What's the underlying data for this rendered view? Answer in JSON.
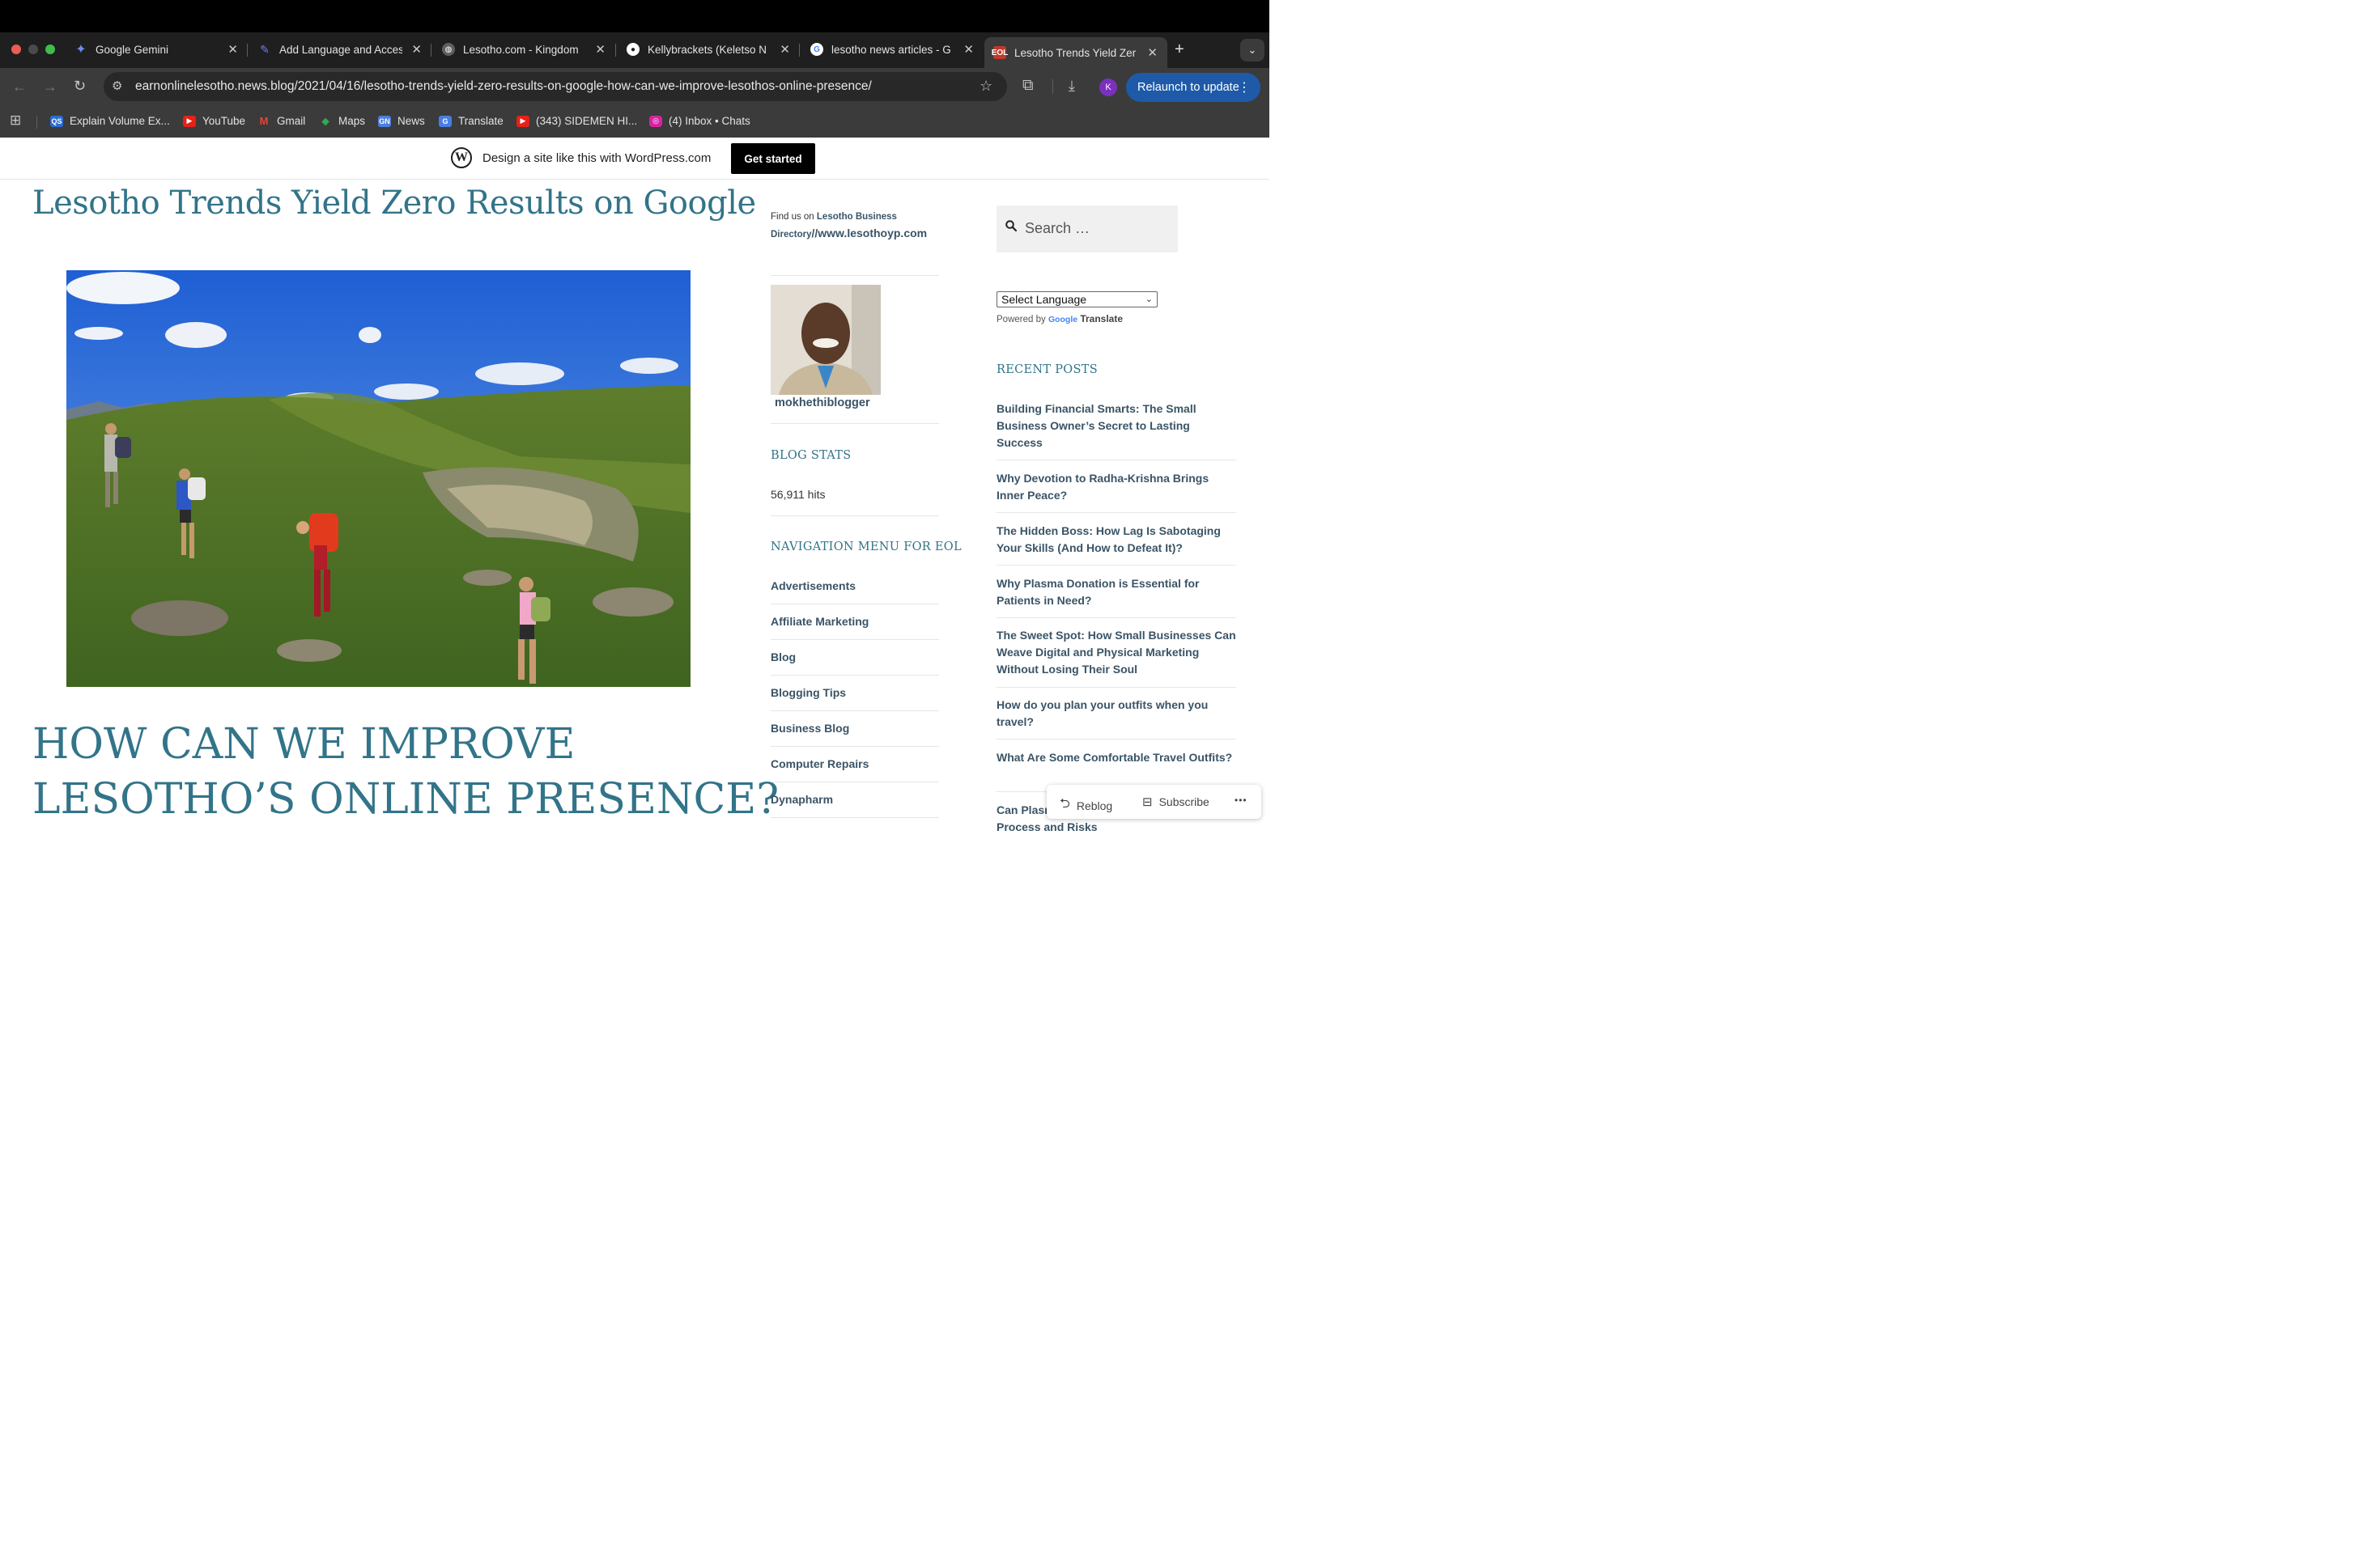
{
  "browser": {
    "tabs": [
      {
        "title": "Google Gemini",
        "favicon": "gemini-icon",
        "active": false
      },
      {
        "title": "Add Language and Acces",
        "favicon": "pencil-icon",
        "active": false
      },
      {
        "title": "Lesotho.com - Kingdom",
        "favicon": "globe-icon",
        "active": false
      },
      {
        "title": "Kellybrackets (Keletso N",
        "favicon": "github-icon",
        "active": false
      },
      {
        "title": "lesotho news articles - G",
        "favicon": "google-icon",
        "active": false
      },
      {
        "title": "Lesotho Trends Yield Zer",
        "favicon": "eol-icon",
        "active": true
      }
    ],
    "url": "earnonlinelesotho.news.blog/2021/04/16/lesotho-trends-yield-zero-results-on-google-how-can-we-improve-lesothos-online-presence/",
    "relaunch_label": "Relaunch to update",
    "profile_initial": "K",
    "bookmarks": [
      {
        "label": "Explain Volume Ex...",
        "icon": "qs-icon"
      },
      {
        "label": "YouTube",
        "icon": "youtube-icon"
      },
      {
        "label": "Gmail",
        "icon": "gmail-icon"
      },
      {
        "label": "Maps",
        "icon": "maps-icon"
      },
      {
        "label": "News",
        "icon": "news-icon"
      },
      {
        "label": "Translate",
        "icon": "translate-icon"
      },
      {
        "label": "(343) SIDEMEN HI...",
        "icon": "youtube-icon"
      },
      {
        "label": "(4) Inbox • Chats",
        "icon": "instagram-icon"
      }
    ]
  },
  "wpbanner": {
    "text": "Design a site like this with WordPress.com",
    "button": "Get started"
  },
  "post": {
    "title": "Lesotho Trends Yield Zero Results on Google",
    "headline_line1": "HOW CAN WE IMPROVE",
    "headline_line2": "LESOTHO’S ONLINE PRESENCE?"
  },
  "sidebar1": {
    "findus_prefix": "Find us on ",
    "findus_bold": "Lesotho Business Directory",
    "findus_link": "//www.lesothoyp.com",
    "username": "mokhethiblogger",
    "stats_title": "BLOG STATS",
    "hits": "56,911 hits",
    "nav_title": "NAVIGATION MENU FOR EOL",
    "nav_items": [
      "Advertisements",
      "Affiliate Marketing",
      "Blog",
      "Blogging Tips",
      "Business Blog",
      "Computer Repairs",
      "Dynapharm"
    ]
  },
  "sidebar2": {
    "search_placeholder": "Search …",
    "language_select": "Select Language",
    "powered_by": "Powered by",
    "google": "Google",
    "translate": "Translate",
    "recent_title": "RECENT POSTS",
    "recent_posts": [
      "Building Financial Smarts: The Small Business Owner’s Secret to Lasting Success",
      "Why Devotion to Radha-Krishna Brings Inner Peace?",
      "The Hidden Boss: How Lag Is Sabotaging Your Skills (And How to Defeat It)?",
      "Why Plasma Donation is Essential for Patients in Need?",
      "The Sweet Spot: How Small Businesses Can Weave Digital and Physical Marketing Without Losing Their Soul",
      "How do you plan your outfits when you travel?",
      "What Are Some Comfortable Travel Outfits?",
      "Can Plasma Donation... Understanding the Process and Risks"
    ]
  },
  "actionbar": {
    "reblog": "Reblog",
    "subscribe": "Subscribe",
    "more": "•••"
  },
  "colors": {
    "accent": "#327489",
    "link": "#3a5466",
    "relaunch": "#1e5aa8"
  }
}
